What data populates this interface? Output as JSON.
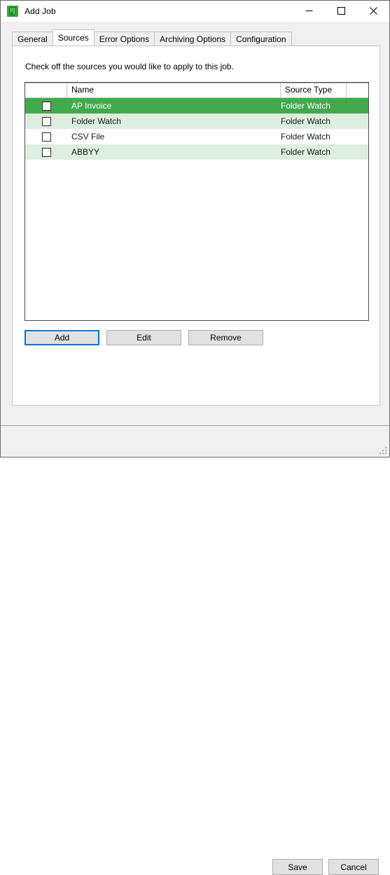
{
  "window": {
    "title": "Add Job",
    "icon": "app-green-job-icon",
    "controls": {
      "minimize": "minimize-icon",
      "maximize": "maximize-icon",
      "close": "close-icon"
    }
  },
  "tabs": [
    {
      "label": "General",
      "active": false
    },
    {
      "label": "Sources",
      "active": true
    },
    {
      "label": "Error Options",
      "active": false
    },
    {
      "label": "Archiving Options",
      "active": false
    },
    {
      "label": "Configuration",
      "active": false
    }
  ],
  "panel": {
    "instruction": "Check off the sources you would like to apply to this job."
  },
  "list": {
    "columns": [
      {
        "key": "check",
        "label": ""
      },
      {
        "key": "name",
        "label": "Name"
      },
      {
        "key": "type",
        "label": "Source Type"
      },
      {
        "key": "extra",
        "label": ""
      }
    ],
    "rows": [
      {
        "checked": false,
        "name": "AP Invoice",
        "type": "Folder Watch",
        "selected": true,
        "alt": false
      },
      {
        "checked": false,
        "name": "Folder Watch",
        "type": "Folder Watch",
        "selected": false,
        "alt": true
      },
      {
        "checked": false,
        "name": "CSV File",
        "type": "Folder Watch",
        "selected": false,
        "alt": false
      },
      {
        "checked": false,
        "name": "ABBYY",
        "type": "Folder Watch",
        "selected": false,
        "alt": true
      }
    ]
  },
  "actions": {
    "add": "Add",
    "edit": "Edit",
    "remove": "Remove"
  },
  "footer": {
    "save": "Save",
    "cancel": "Cancel"
  },
  "colors": {
    "selected_row": "#43a94d",
    "alt_row": "#ddeede",
    "focus_border": "#0078d7",
    "app_icon": "#3aa83f",
    "window_chrome": "#f0f0f0"
  }
}
